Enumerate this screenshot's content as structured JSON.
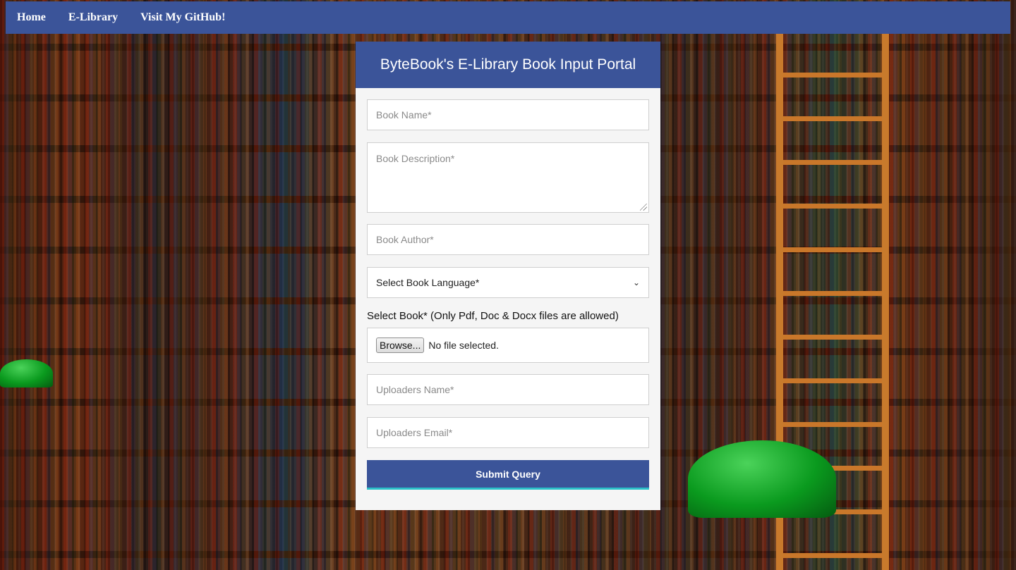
{
  "nav": {
    "items": [
      {
        "label": "Home"
      },
      {
        "label": "E-Library"
      },
      {
        "label": "Visit My GitHub!"
      }
    ]
  },
  "card": {
    "title": "ByteBook's E-Library Book Input Portal"
  },
  "form": {
    "book_name_placeholder": "Book Name*",
    "book_description_placeholder": "Book Description*",
    "book_author_placeholder": "Book Author*",
    "language_selected": "Select Book Language*",
    "file_label": "Select Book* (Only Pdf, Doc & Docx files are allowed)",
    "browse_label": "Browse...",
    "file_status": "No file selected.",
    "uploader_name_placeholder": "Uploaders Name*",
    "uploader_email_placeholder": "Uploaders Email*",
    "submit_label": "Submit Query"
  },
  "colors": {
    "primary": "#3b5499",
    "submit_underline": "#2bc0c8",
    "card_bg": "#f5f5f5"
  },
  "icons": {
    "select_chevron": "chevron-down-icon",
    "textarea_grip": "resize-grip-icon"
  }
}
